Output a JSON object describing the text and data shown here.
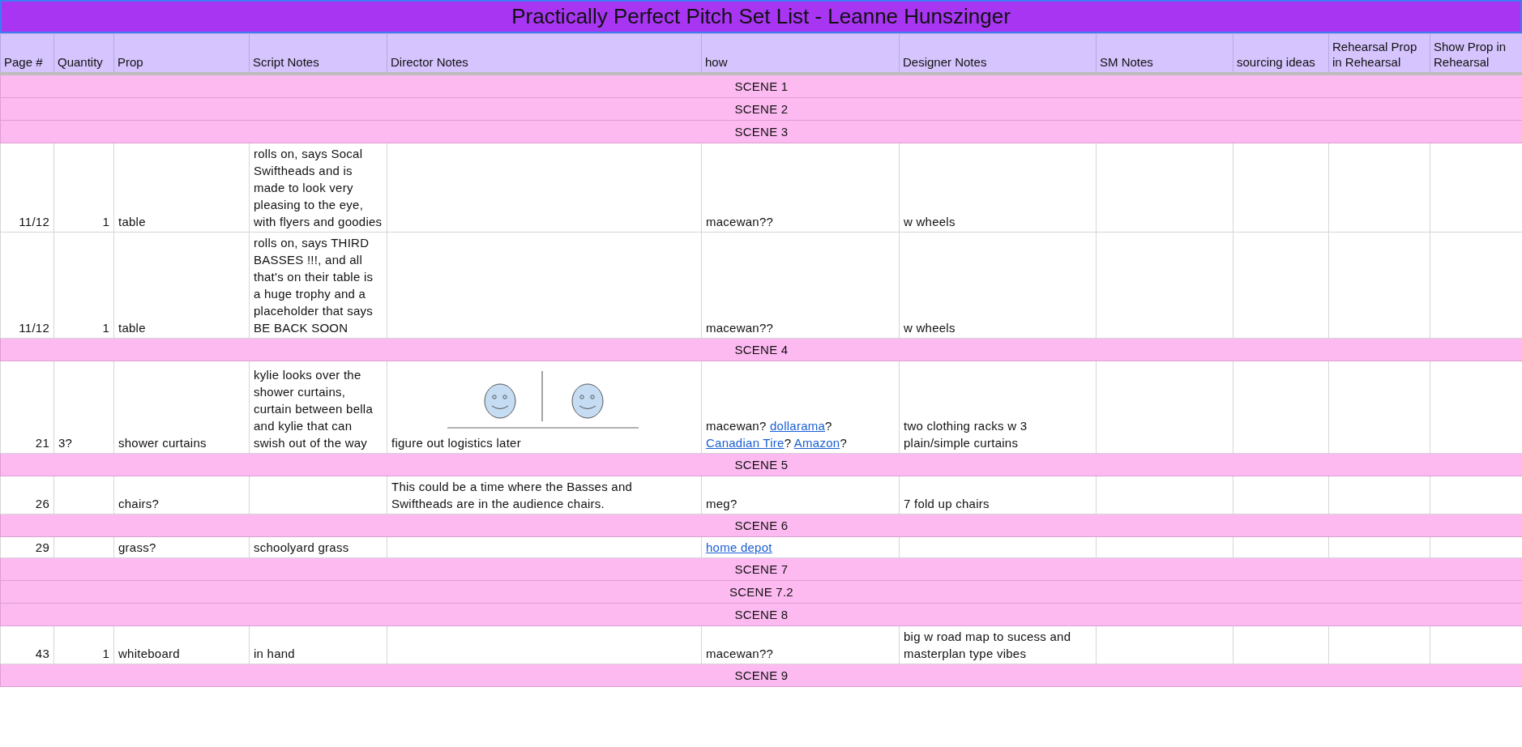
{
  "title": "Practically Perfect Pitch Set List - Leanne Hunszinger",
  "columns": [
    "Page #",
    "Quantity",
    "Prop",
    "Script Notes",
    "Director Notes",
    "how",
    "Designer Notes",
    "SM Notes",
    "sourcing ideas",
    "Rehearsal Prop in Rehearsal",
    "Show Prop in Rehearsal"
  ],
  "rows": [
    {
      "kind": "scene",
      "label": "SCENE 1"
    },
    {
      "kind": "scene",
      "label": "SCENE 2"
    },
    {
      "kind": "scene",
      "label": "SCENE 3"
    },
    {
      "kind": "item",
      "page": "11/12",
      "quantity": "1",
      "prop": "table",
      "script_notes": "rolls on, says Socal Swiftheads and is made to look very pleasing to the eye, with flyers and goodies",
      "director_notes": "",
      "sketch": false,
      "how": [
        {
          "text": "macewan??",
          "link": false
        }
      ],
      "designer_notes": "w wheels"
    },
    {
      "kind": "item",
      "page": "11/12",
      "quantity": "1",
      "prop": "table",
      "script_notes": "rolls on, says THIRD BASSES !!!, and all that's on their table is a huge trophy and a placeholder that says BE BACK SOON",
      "director_notes": "",
      "sketch": false,
      "how": [
        {
          "text": "macewan??",
          "link": false
        }
      ],
      "designer_notes": "w wheels"
    },
    {
      "kind": "scene",
      "label": "SCENE 4"
    },
    {
      "kind": "item",
      "page": "21",
      "quantity": "3?",
      "prop": "shower curtains",
      "script_notes": "kylie looks over the shower curtains, curtain between bella and kylie that can swish out of the way",
      "director_notes": "figure out logistics later",
      "sketch": true,
      "how": [
        {
          "text": "macewan? ",
          "link": false
        },
        {
          "text": "dollarama",
          "link": true
        },
        {
          "text": "? ",
          "link": false
        },
        {
          "text": "Canadian Tire",
          "link": true
        },
        {
          "text": "? ",
          "link": false
        },
        {
          "text": "Amazon",
          "link": true
        },
        {
          "text": "?",
          "link": false
        }
      ],
      "designer_notes": "two clothing racks w 3 plain/simple curtains"
    },
    {
      "kind": "scene",
      "label": "SCENE 5"
    },
    {
      "kind": "item",
      "page": "26",
      "quantity": "",
      "prop": "chairs?",
      "script_notes": "",
      "director_notes": "This could be a time where the Basses and Swiftheads are in the audience chairs.",
      "sketch": false,
      "how": [
        {
          "text": "meg?",
          "link": false
        }
      ],
      "designer_notes": "7 fold up chairs"
    },
    {
      "kind": "scene",
      "label": "SCENE 6"
    },
    {
      "kind": "item",
      "page": "29",
      "quantity": "",
      "prop": "grass?",
      "script_notes": "schoolyard grass",
      "director_notes": "",
      "sketch": false,
      "how": [
        {
          "text": "home depot",
          "link": true
        }
      ],
      "designer_notes": ""
    },
    {
      "kind": "scene",
      "label": "SCENE 7"
    },
    {
      "kind": "scene",
      "label": "SCENE 7.2"
    },
    {
      "kind": "scene",
      "label": "SCENE 8"
    },
    {
      "kind": "item",
      "page": "43",
      "quantity": "1",
      "prop": "whiteboard",
      "script_notes": "in hand",
      "director_notes": "",
      "sketch": false,
      "how": [
        {
          "text": "macewan??",
          "link": false
        }
      ],
      "designer_notes": "big w road map to sucess and masterplan type vibes"
    },
    {
      "kind": "scene",
      "label": "SCENE 9"
    }
  ]
}
